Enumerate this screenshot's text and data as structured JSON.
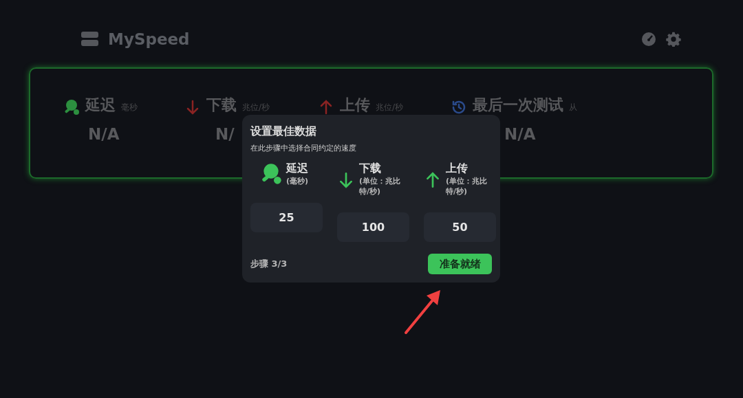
{
  "header": {
    "title": "MySpeed"
  },
  "stats": [
    {
      "kind": "ping",
      "label": "延迟",
      "unit": "毫秒",
      "value": "N/A"
    },
    {
      "kind": "download",
      "label": "下载",
      "unit": "兆位/秒",
      "value": "N/"
    },
    {
      "kind": "upload",
      "label": "上传",
      "unit": "兆位/秒"
    },
    {
      "kind": "time",
      "label": "最后一次测试",
      "unit": "从",
      "value": "N/A"
    }
  ],
  "dialog": {
    "title": "设置最佳数据",
    "subtitle": "在此步骤中选择合同约定的速度",
    "fields": [
      {
        "kind": "ping",
        "label": "延迟",
        "unit": "(毫秒)",
        "value": "25"
      },
      {
        "kind": "download",
        "label": "下载",
        "unit": "(单位：兆比特/秒)",
        "value": "100"
      },
      {
        "kind": "upload",
        "label": "上传",
        "unit": "(单位：兆比特/秒)",
        "value": "50"
      }
    ],
    "step": "步骤 3/3",
    "button": "准备就绪"
  },
  "annotation": {
    "kind": "arrow"
  }
}
